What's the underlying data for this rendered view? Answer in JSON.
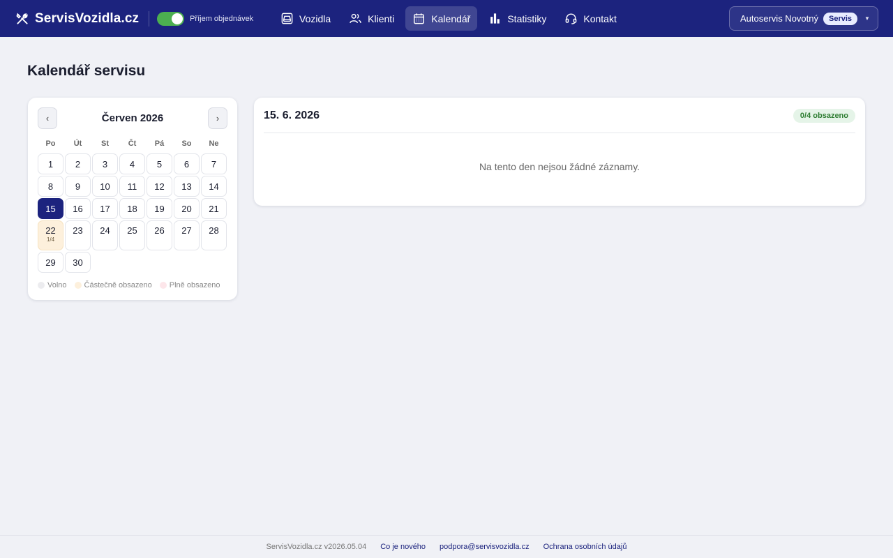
{
  "brand": {
    "name": "ServisVozidla.cz",
    "toggle_label": "Příjem objednávek",
    "toggle_on": true
  },
  "nav": [
    {
      "label": "Vozidla",
      "icon": "car-icon",
      "active": false
    },
    {
      "label": "Klienti",
      "icon": "users-icon",
      "active": false
    },
    {
      "label": "Kalendář",
      "icon": "calendar-icon",
      "active": true
    },
    {
      "label": "Statistiky",
      "icon": "bar-chart-icon",
      "active": false
    },
    {
      "label": "Kontakt",
      "icon": "headset-icon",
      "active": false
    }
  ],
  "account": {
    "name": "Autoservis Novotný",
    "badge": "Servis"
  },
  "page": {
    "title": "Kalendář servisu"
  },
  "calendar": {
    "month_label": "Červen 2026",
    "prev": "‹",
    "next": "›",
    "weekdays": [
      "Po",
      "Út",
      "St",
      "Čt",
      "Pá",
      "So",
      "Ne"
    ],
    "selected_day": 15,
    "days": [
      {
        "day": "1"
      },
      {
        "day": "2"
      },
      {
        "day": "3"
      },
      {
        "day": "4"
      },
      {
        "day": "5"
      },
      {
        "day": "6"
      },
      {
        "day": "7"
      },
      {
        "day": "8"
      },
      {
        "day": "9"
      },
      {
        "day": "10"
      },
      {
        "day": "11"
      },
      {
        "day": "12"
      },
      {
        "day": "13"
      },
      {
        "day": "14"
      },
      {
        "day": "15",
        "selected": true
      },
      {
        "day": "16"
      },
      {
        "day": "17"
      },
      {
        "day": "18"
      },
      {
        "day": "19"
      },
      {
        "day": "20"
      },
      {
        "day": "21"
      },
      {
        "day": "22",
        "status": "partial",
        "occupancy": "1/4"
      },
      {
        "day": "23"
      },
      {
        "day": "24"
      },
      {
        "day": "25"
      },
      {
        "day": "26"
      },
      {
        "day": "27"
      },
      {
        "day": "28"
      },
      {
        "day": "29"
      },
      {
        "day": "30"
      }
    ],
    "legend": [
      {
        "label": "Volno",
        "color": "#ececef"
      },
      {
        "label": "Částečně obsazeno",
        "color": "#fdf0dc"
      },
      {
        "label": "Plně obsazeno",
        "color": "#fde6ea"
      }
    ]
  },
  "detail": {
    "date": "15. 6. 2026",
    "occupancy_badge": "0/4 obsazeno",
    "empty_message": "Na tento den nejsou žádné záznamy."
  },
  "footer": {
    "version": "ServisVozidla.cz v2026.05.04",
    "links": [
      "Co je nového",
      "podpora@servisvozidla.cz",
      "Ochrana osobních údajů"
    ]
  },
  "colors": {
    "header": "#1c237e",
    "toggle": "#4caf50",
    "selected_day": "#1c237e",
    "partial_day": "#fdf0dc"
  }
}
